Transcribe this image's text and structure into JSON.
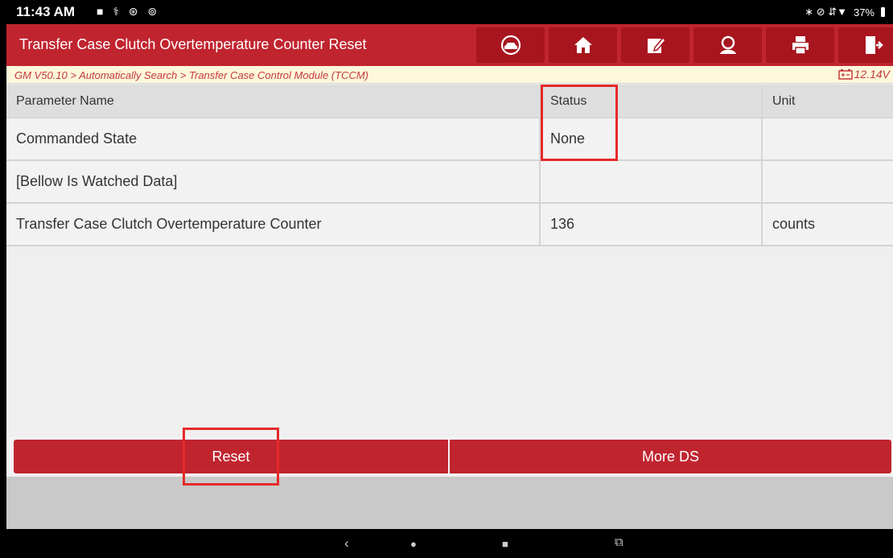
{
  "status_bar": {
    "time": "11:43 AM",
    "left_icons": "■ ⚕ ⊛ ⊚",
    "right_icons": "∗ ⊘ ⇵▼",
    "battery": "37%"
  },
  "title_bar": {
    "title": "Transfer Case Clutch Overtemperature Counter Reset",
    "toolbar": [
      "vehicle-icon",
      "home-icon",
      "edit-icon",
      "user-icon",
      "print-icon",
      "exit-icon"
    ]
  },
  "breadcrumb": {
    "path": "GM V50.10 > Automatically Search > Transfer Case Control Module (TCCM)",
    "voltage": "12.14V"
  },
  "table": {
    "headers": [
      "Parameter Name",
      "Status",
      "Unit"
    ],
    "rows": [
      [
        "Commanded State",
        "None",
        ""
      ],
      [
        "[Bellow Is Watched Data]",
        "",
        ""
      ],
      [
        "Transfer Case Clutch Overtemperature Counter",
        "136",
        "counts"
      ]
    ]
  },
  "actions": {
    "reset": "Reset",
    "more": "More DS"
  },
  "nav": {
    "back": "‹",
    "home": "●",
    "recent": "■",
    "extra": "⧉"
  },
  "colors": {
    "brand_red": "#c0242f",
    "highlight_red": "#e52a2a"
  }
}
